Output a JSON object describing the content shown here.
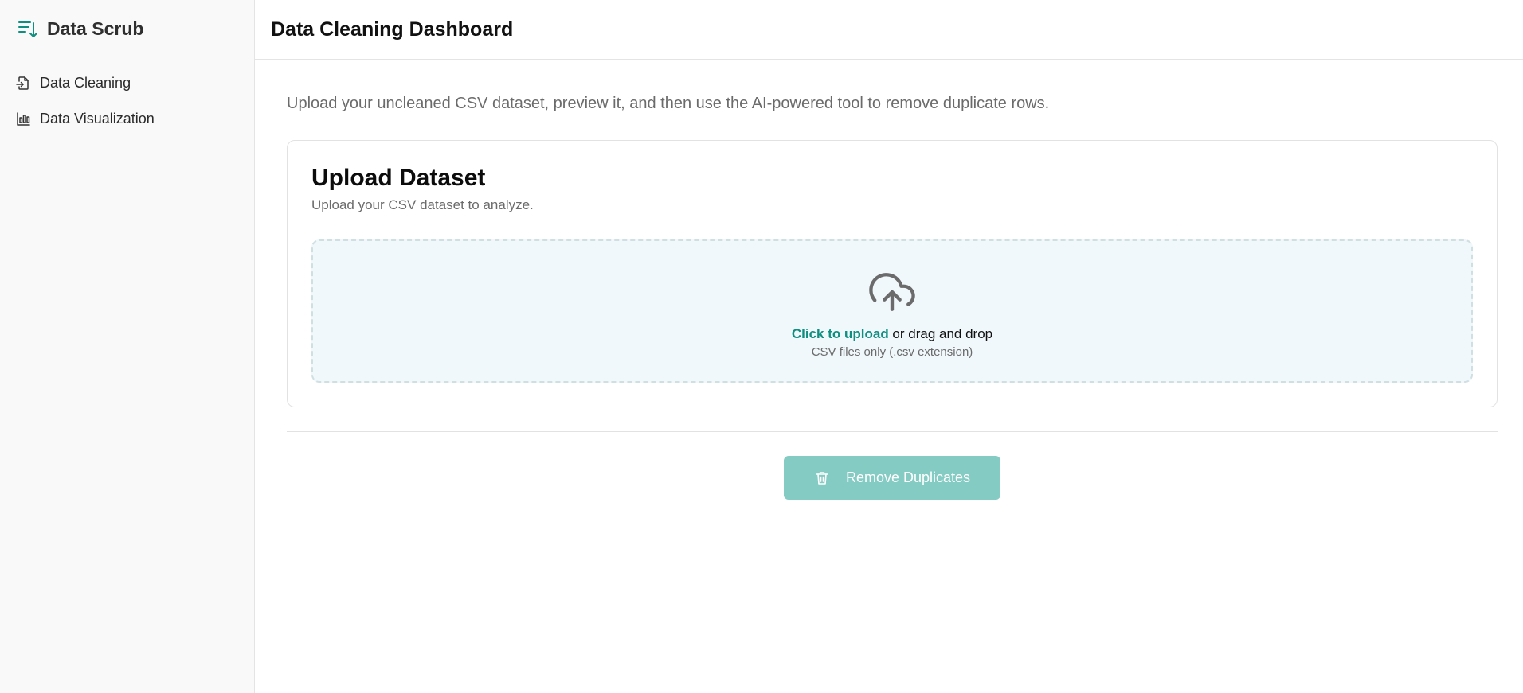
{
  "brand": {
    "name": "Data Scrub",
    "icon": "sort-list-icon"
  },
  "sidebar": {
    "items": [
      {
        "label": "Data Cleaning",
        "icon": "file-import-icon"
      },
      {
        "label": "Data Visualization",
        "icon": "bar-chart-icon"
      }
    ]
  },
  "header": {
    "title": "Data Cleaning Dashboard"
  },
  "main": {
    "intro": "Upload your uncleaned CSV dataset, preview it, and then use the AI-powered tool to remove duplicate rows.",
    "upload_card": {
      "title": "Upload Dataset",
      "subtitle": "Upload your CSV dataset to analyze.",
      "dropzone": {
        "icon": "cloud-upload-icon",
        "link_text": "Click to upload",
        "rest_text": " or drag and drop",
        "hint": "CSV files only (.csv extension)"
      }
    },
    "remove_button": {
      "label": "Remove Duplicates",
      "icon": "trash-icon",
      "disabled": true
    }
  },
  "colors": {
    "accent": "#0f8f80",
    "button_disabled": "#84cbc3",
    "dropzone_bg": "#f0f8fb",
    "sidebar_bg": "#f9f9f9"
  }
}
